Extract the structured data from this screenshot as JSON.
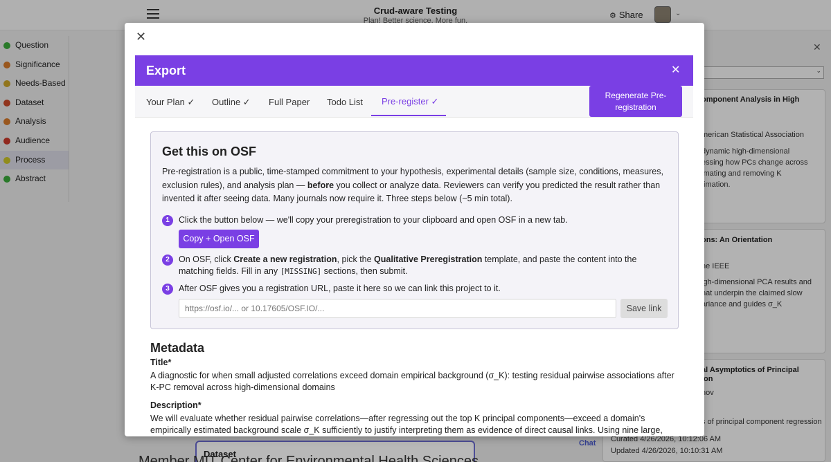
{
  "app": {
    "title": "Crud-aware Testing",
    "subtitle": "Plan! Better science. More fun.",
    "share_label": "Share"
  },
  "sidebar": {
    "items": [
      {
        "label": "Question",
        "color": "#3aa83a"
      },
      {
        "label": "Significance",
        "color": "#d4792a"
      },
      {
        "label": "Needs-Based",
        "color": "#c9a227"
      },
      {
        "label": "Dataset",
        "color": "#c94a2a"
      },
      {
        "label": "Analysis",
        "color": "#d4792a"
      },
      {
        "label": "Audience",
        "color": "#c93a2a"
      },
      {
        "label": "Process",
        "color": "#c9c227"
      },
      {
        "label": "Abstract",
        "color": "#3aa83a"
      }
    ]
  },
  "references": {
    "card1": {
      "title": "omponent Analysis in High",
      "lines": [
        "merican Statistical Association",
        "dynamic high-dimensional",
        "essing how PCs change across",
        "imating and removing K",
        "timation."
      ]
    },
    "card2": {
      "title": "ons: An Orientation",
      "lines": [
        "he IEEE",
        "igh-dimensional PCA results and",
        "hat underpin the claimed slow",
        "ariance and guides σ_K"
      ]
    },
    "card3": {
      "title_line1": "al Asymptotics of Principal",
      "title_line2": "ion",
      "lines": [
        "nov",
        "s of principal component regression"
      ]
    },
    "curated": "Curated 4/26/2026, 10:12:06 AM",
    "updated": "Updated 4/26/2026, 10:10:31 AM"
  },
  "background": {
    "chat_label": "Chat",
    "dataset_label": "Dataset",
    "member_text": "Member MIT Center for Environmental Health Sciences"
  },
  "modal": {
    "export_title": "Export",
    "tabs": [
      {
        "label": "Your Plan ✓"
      },
      {
        "label": "Outline ✓"
      },
      {
        "label": "Full Paper"
      },
      {
        "label": "Todo List"
      },
      {
        "label": "Pre-register ✓"
      }
    ],
    "active_tab": "Pre-register ✓",
    "regen_line1": "Regenerate Pre-",
    "regen_line2": "registration",
    "osf": {
      "title": "Get this on OSF",
      "intro_a": "Pre-registration is a public, time-stamped commitment to your hypothesis, experimental details (sample size, conditions, measures, exclusion rules), and analysis plan — ",
      "intro_bold": "before",
      "intro_b": " you collect or analyze data. Reviewers can verify you predicted the result rather than invented it after seeing data. Many journals now require it. Three steps below (~5 min total).",
      "step1_num": "1",
      "step1_text": "Click the button below — we'll copy your preregistration to your clipboard and open OSF in a new tab.",
      "copy_button": "Copy + Open OSF",
      "step2_num": "2",
      "step2_a": "On OSF, click ",
      "step2_b": "Create a new registration",
      "step2_c": ", pick the ",
      "step2_d": "Qualitative Preregistration",
      "step2_e": " template, and paste the content into the matching fields. Fill in any ",
      "step2_code": "[MISSING]",
      "step2_f": " sections, then submit.",
      "step3_num": "3",
      "step3_text": "After OSF gives you a registration URL, paste it here so we can link this project to it.",
      "url_placeholder": "https://osf.io/... or 10.17605/OSF.IO/...",
      "save_button": "Save link"
    },
    "metadata": {
      "heading": "Metadata",
      "title_label": "Title*",
      "title_value": "A diagnostic for when small adjusted correlations exceed domain empirical background (σ_K): testing residual pairwise associations after K-PC removal across high-dimensional domains",
      "description_label": "Description*",
      "description_value": "We will evaluate whether residual pairwise correlations—after regressing out the top K principal components—exceed a domain's empirically estimated background scale σ_K sufficiently to justify interpreting them as evidence of direct causal links. Using nine large, heterogeneous existing"
    }
  }
}
